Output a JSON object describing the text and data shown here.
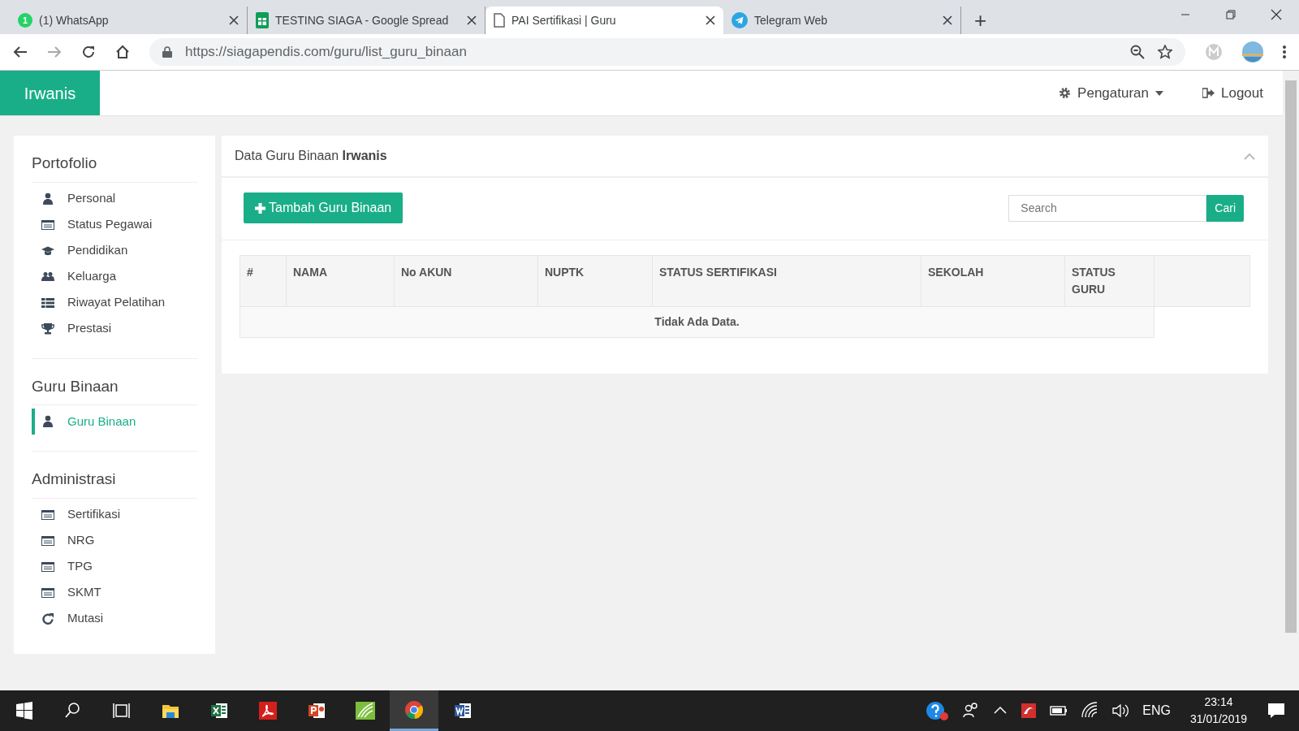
{
  "browser": {
    "tabs": [
      {
        "kind": "whatsapp",
        "badge": "1",
        "title": "(1) WhatsApp",
        "selected": false
      },
      {
        "kind": "sheets",
        "title": "TESTING SIAGA - Google Spread",
        "selected": false
      },
      {
        "kind": "page",
        "title": "PAI Sertifikasi | Guru",
        "selected": true
      },
      {
        "kind": "telegram",
        "title": "Telegram Web",
        "selected": false
      }
    ],
    "new_tab": "+",
    "url": "https://siagapendis.com/guru/list_guru_binaan"
  },
  "header": {
    "brand": "Irwanis",
    "settings": "Pengaturan",
    "logout": "Logout"
  },
  "sidebar": {
    "sections": [
      {
        "title": "Portofolio",
        "items": [
          {
            "kind": "user",
            "label": "Personal",
            "selected": false
          },
          {
            "kind": "card",
            "label": "Status Pegawai",
            "selected": false
          },
          {
            "kind": "cap",
            "label": "Pendidikan",
            "selected": false
          },
          {
            "kind": "users",
            "label": "Keluarga",
            "selected": false
          },
          {
            "kind": "list",
            "label": "Riwayat Pelatihan",
            "selected": false
          },
          {
            "kind": "trophy",
            "label": "Prestasi",
            "selected": false
          }
        ]
      },
      {
        "title": "Guru Binaan",
        "items": [
          {
            "kind": "user",
            "label": "Guru Binaan",
            "selected": true
          }
        ]
      },
      {
        "title": "Administrasi",
        "items": [
          {
            "kind": "card",
            "label": "Sertifikasi",
            "selected": false
          },
          {
            "kind": "card",
            "label": "NRG",
            "selected": false
          },
          {
            "kind": "card",
            "label": "TPG",
            "selected": false
          },
          {
            "kind": "card",
            "label": "SKMT",
            "selected": false
          },
          {
            "kind": "refresh",
            "label": "Mutasi",
            "selected": false
          }
        ]
      }
    ]
  },
  "panel": {
    "title": "Data Guru Binaan **Irwanis**",
    "add_button": "Tambah Guru Binaan",
    "search": {
      "placeholder": "Search",
      "button": "Cari"
    },
    "table": {
      "columns": [
        "#",
        "NAMA",
        "No AKUN",
        "NUPTK",
        "STATUS SERTIFIKASI",
        "SEKOLAH",
        "STATUS GURU"
      ],
      "empty_message": "Tidak Ada Data."
    }
  },
  "taskbar": {
    "language": "ENG",
    "time": "23:14",
    "date": "31/01/2019"
  }
}
